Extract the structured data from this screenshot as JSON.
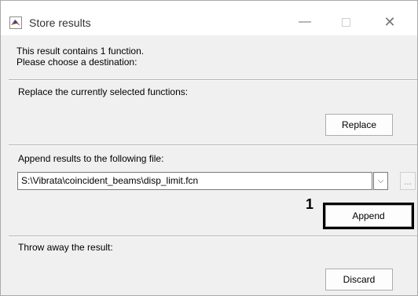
{
  "window": {
    "title": "Store results",
    "icon": "matlab-icon",
    "controls": {
      "minimize": "—",
      "close": "✕"
    }
  },
  "info": {
    "line1": "This result contains 1 function.",
    "line2": "Please choose a destination:"
  },
  "replace_section": {
    "label": "Replace the currently selected functions:",
    "button": "Replace"
  },
  "append_section": {
    "label": "Append results to the following file:",
    "file_path": "S:\\Vibrata\\coincident_beams\\disp_limit.fcn",
    "browse": "...",
    "button": "Append"
  },
  "discard_section": {
    "label": "Throw away the result:",
    "button": "Discard"
  },
  "annotation": {
    "number": "1",
    "highlight_color": "#000000"
  }
}
